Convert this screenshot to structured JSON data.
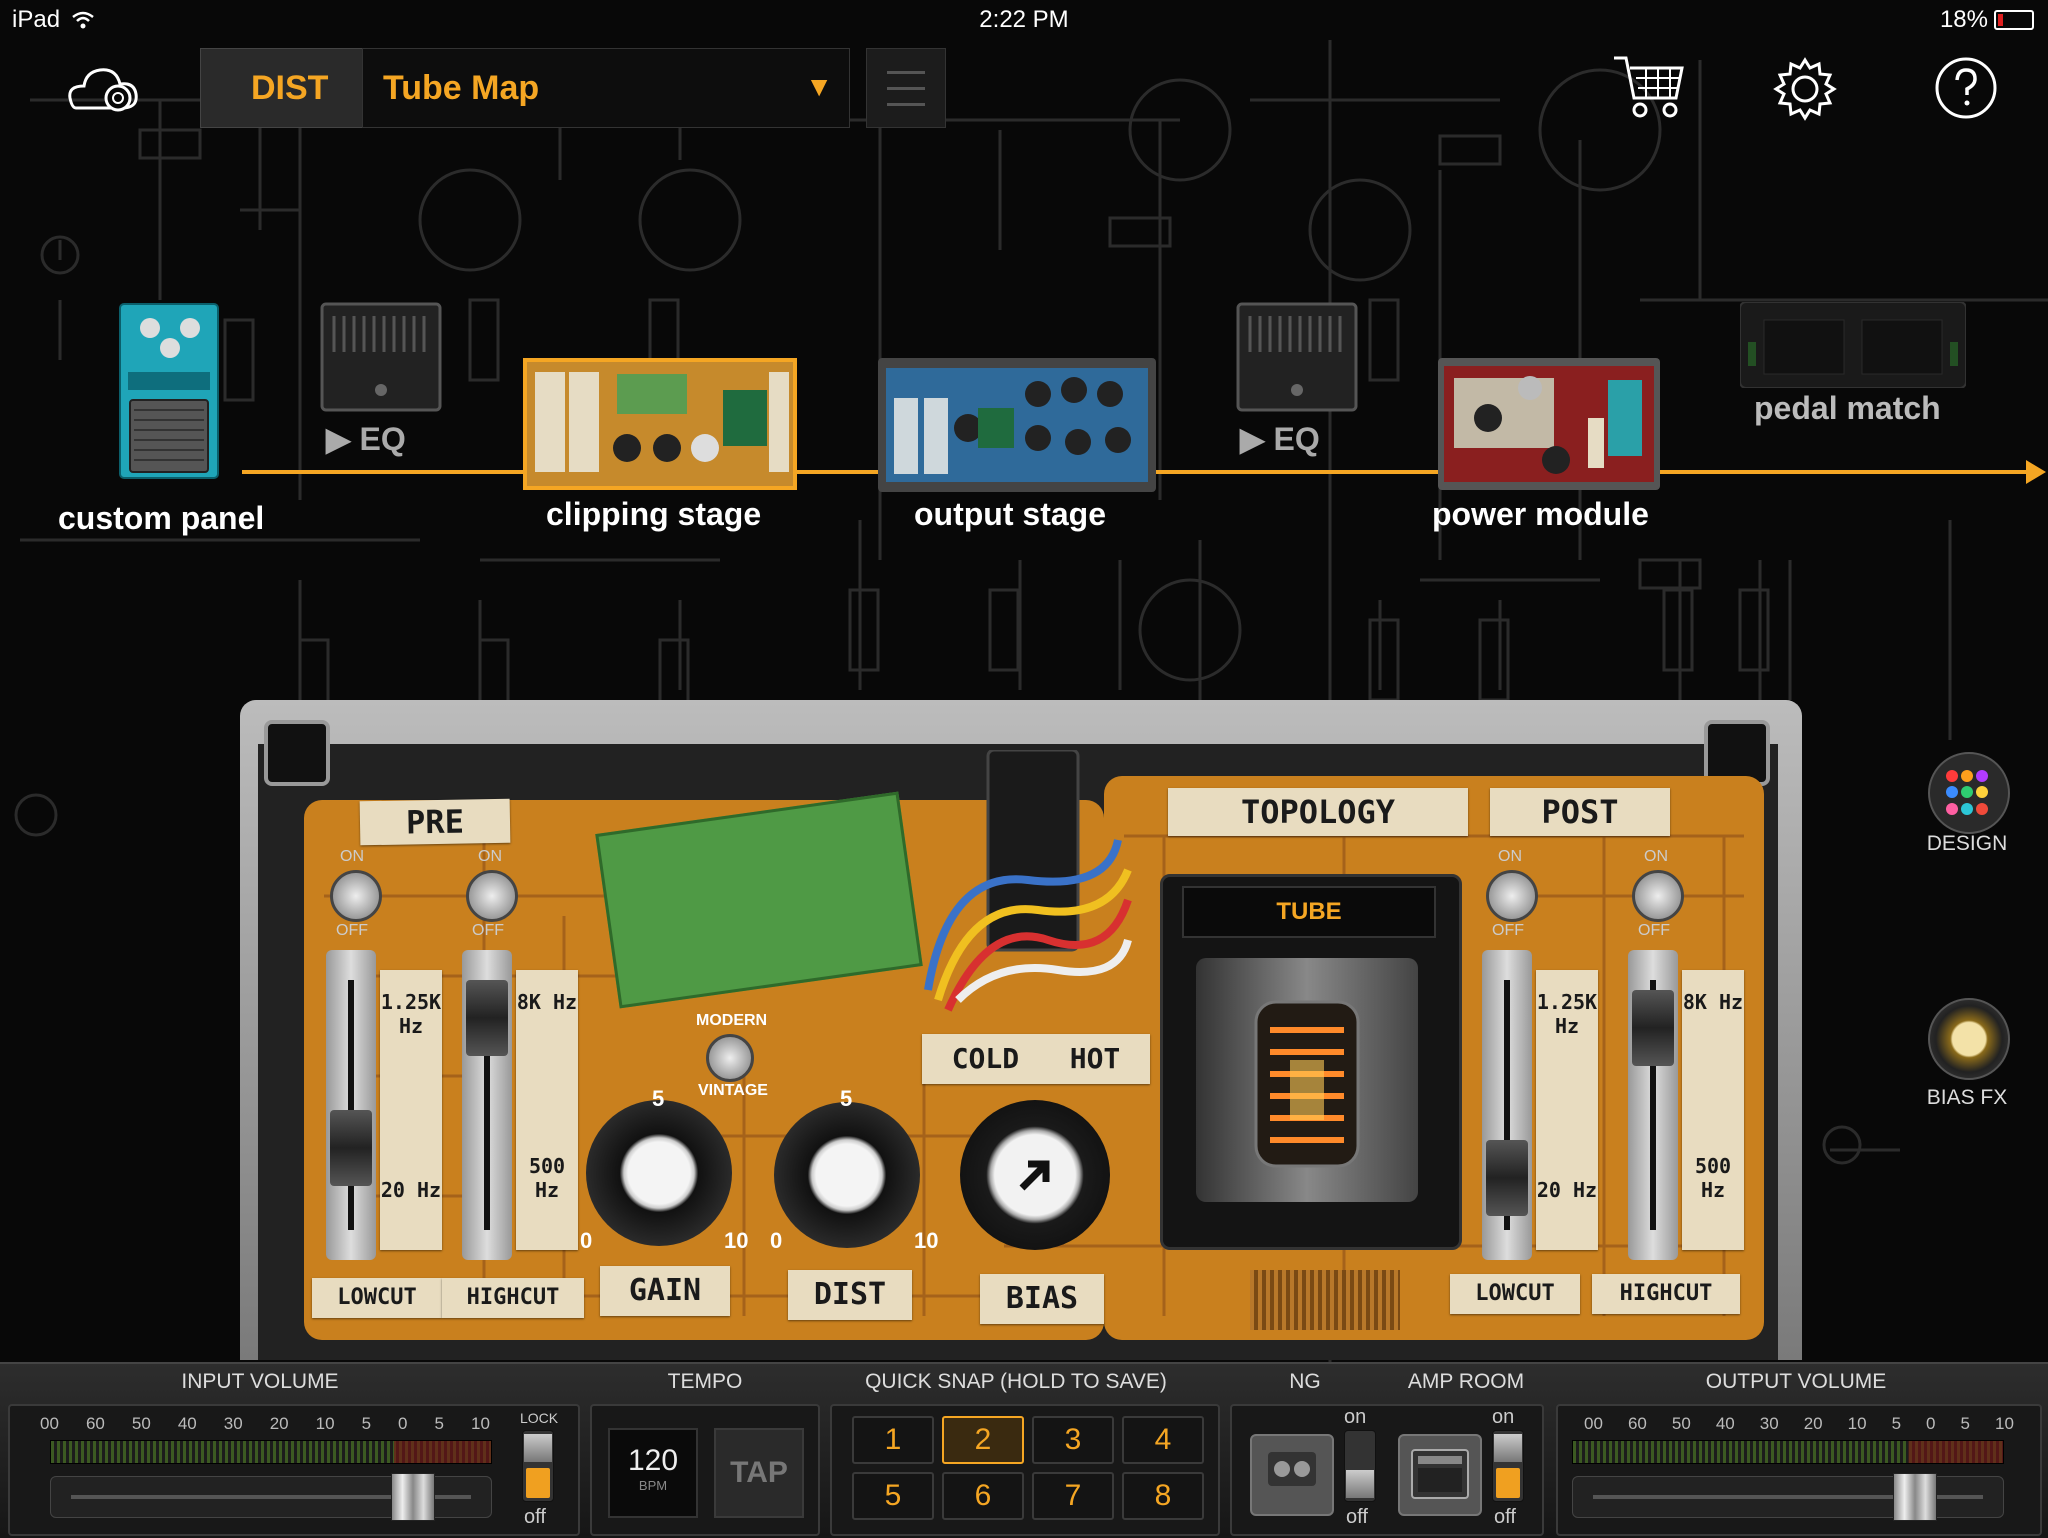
{
  "status_bar": {
    "device": "iPad",
    "time": "2:22 PM",
    "battery": "18%"
  },
  "top_bar": {
    "category": "DIST",
    "preset_name": "Tube Map",
    "preset_arrow": "▼"
  },
  "chain": {
    "modules": [
      {
        "label": "custom panel"
      },
      {
        "label": "▶ EQ"
      },
      {
        "label": "clipping stage"
      },
      {
        "label": "output stage"
      },
      {
        "label": "▶ EQ"
      },
      {
        "label": "power module"
      },
      {
        "label": "pedal match"
      }
    ]
  },
  "pedal": {
    "sections": {
      "pre": "PRE",
      "topology": "TOPOLOGY",
      "post": "POST"
    },
    "switch_on": "ON",
    "switch_off": "OFF",
    "pre_lowcut": {
      "top": "1.25K Hz",
      "bottom": "20 Hz",
      "label": "LOWCUT"
    },
    "pre_highcut": {
      "top": "8K Hz",
      "bottom": "500 Hz",
      "label": "HIGHCUT"
    },
    "post_lowcut": {
      "top": "1.25K Hz",
      "bottom": "20 Hz",
      "label": "LOWCUT"
    },
    "post_highcut": {
      "top": "8K Hz",
      "bottom": "500 Hz",
      "label": "HIGHCUT"
    },
    "mode_switch": {
      "top": "MODERN",
      "bottom": "VINTAGE"
    },
    "gain": {
      "label": "GAIN",
      "min": "0",
      "mid": "5",
      "max": "10"
    },
    "dist": {
      "label": "DIST",
      "min": "0",
      "mid": "5",
      "max": "10"
    },
    "bias": {
      "label": "BIAS",
      "cold": "COLD",
      "hot": "HOT"
    },
    "tube_label": "TUBE"
  },
  "side": {
    "design": "DESIGN",
    "biasfx": "BIAS FX",
    "design_dots": [
      "#ff3b3b",
      "#ff9f1c",
      "#b23bff",
      "#3b8cff",
      "#2ecc71",
      "#ffd23b",
      "#ff5fa2",
      "#2cc6d6",
      "#f04a3a"
    ]
  },
  "bottom_bar": {
    "input_volume": {
      "title": "INPUT VOLUME",
      "scale": [
        "00",
        "60",
        "50",
        "40",
        "30",
        "20",
        "10",
        "5",
        "0",
        "5",
        "10"
      ],
      "lock": "LOCK",
      "lock_state": "off",
      "slider_level": 0.85
    },
    "tempo": {
      "title": "TEMPO",
      "bpm": "120",
      "bpm_unit": "BPM",
      "tap": "TAP"
    },
    "quick_snap": {
      "title": "QUICK SNAP (HOLD TO SAVE)",
      "slots": [
        "1",
        "2",
        "3",
        "4",
        "5",
        "6",
        "7",
        "8"
      ],
      "selected": "2"
    },
    "ng": {
      "title": "NG",
      "on": "on",
      "off": "off"
    },
    "amp_room": {
      "title": "AMP ROOM",
      "on": "on",
      "off": "off"
    },
    "output_volume": {
      "title": "OUTPUT VOLUME",
      "scale": [
        "00",
        "60",
        "50",
        "40",
        "30",
        "20",
        "10",
        "5",
        "0",
        "5",
        "10"
      ],
      "slider_level": 0.82
    }
  },
  "colors": {
    "accent": "#f5a623",
    "pcb": "#c9801e",
    "tape": "#e8dcc0"
  }
}
